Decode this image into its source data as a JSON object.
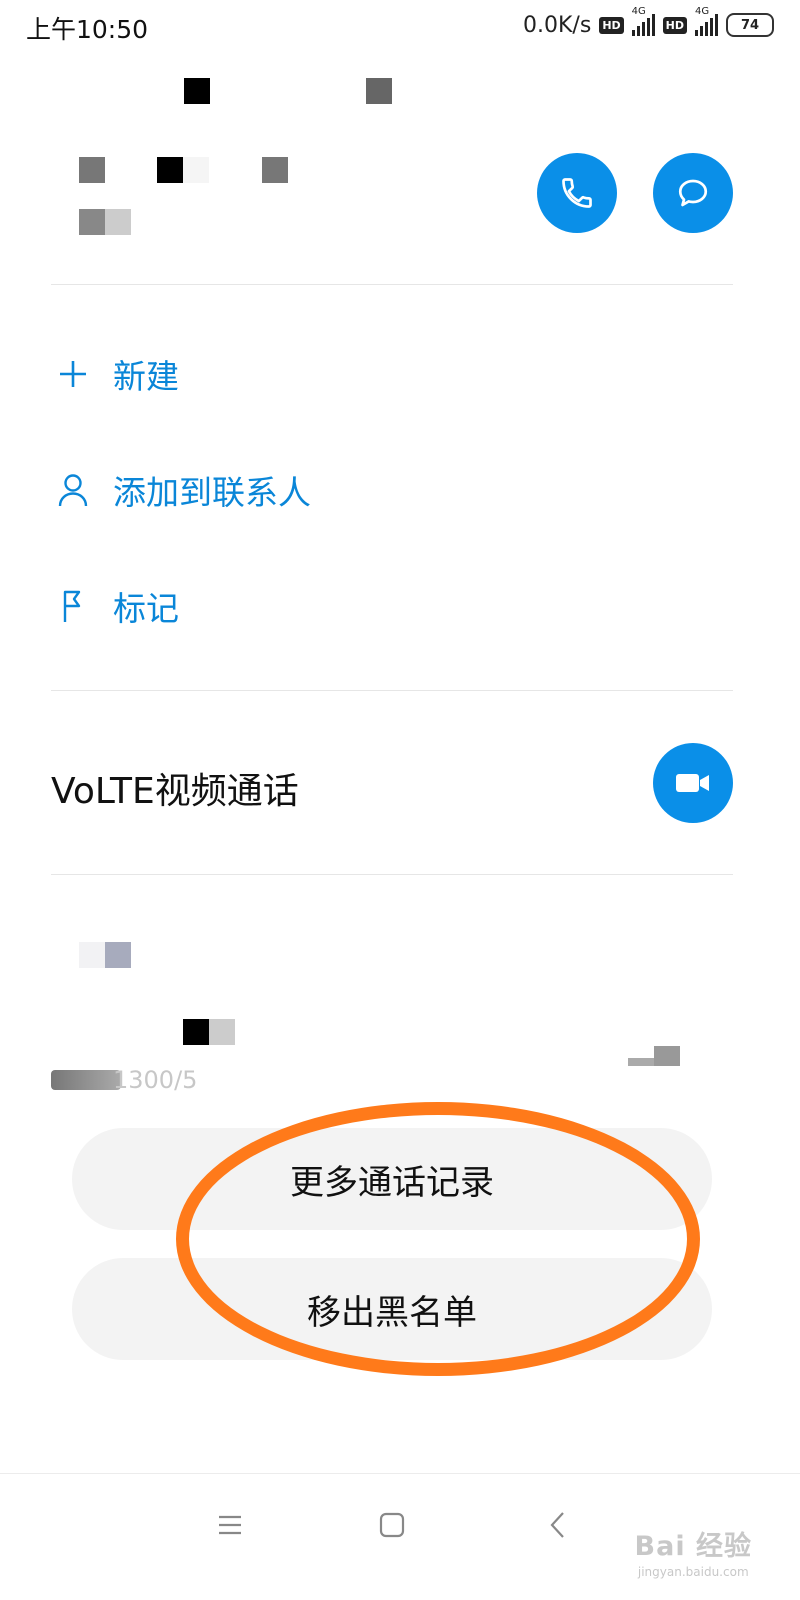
{
  "status_bar": {
    "time": "上午10:50",
    "net_speed": "0.0K/s",
    "hd1": "HD",
    "hd2": "HD",
    "net1": "4G",
    "net2": "4G",
    "battery": "74"
  },
  "actions": {
    "call_icon": "phone-icon",
    "message_icon": "message-icon"
  },
  "menu": {
    "new_label": "新建",
    "add_contact_label": "添加到联系人",
    "mark_label": "标记"
  },
  "volte": {
    "label": "VoLTE视频通话",
    "icon": "video-camera-icon"
  },
  "call_log": {
    "partial_number": "1300/5"
  },
  "buttons": {
    "more_calls": "更多通话记录",
    "remove_blacklist": "移出黑名单"
  },
  "watermark": {
    "brand": "Bai 经验",
    "url": "jingyan.baidu.com"
  },
  "colors": {
    "accent": "#0a8fe8",
    "annotation": "#ff7a1a"
  }
}
